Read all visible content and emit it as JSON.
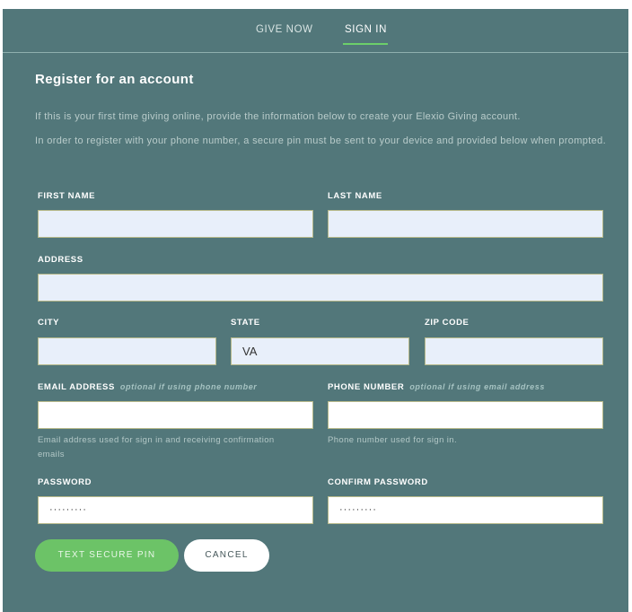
{
  "nav": {
    "tabs": [
      "GIVE NOW",
      "SIGN IN"
    ],
    "active": "SIGN IN"
  },
  "heading": "Register for an account",
  "intro_1": "If this is your first time giving online, provide the information below to create your Elexio Giving account.",
  "intro_2": "In order to register with your phone number, a secure pin must be sent to your device and provided below when prompted.",
  "form": {
    "first_name_label": "FIRST NAME",
    "last_name_label": "LAST NAME",
    "address_label": "ADDRESS",
    "city_label": "CITY",
    "state_label": "STATE",
    "state_value": "VA",
    "zip_label": "ZIP CODE",
    "email_label": "EMAIL ADDRESS",
    "email_optional": "optional if using phone number",
    "email_help": "Email address used for sign in and receiving confirmation emails",
    "phone_label": "PHONE NUMBER",
    "phone_optional": "optional if using email address",
    "phone_help": "Phone number used for sign in.",
    "password_label": "PASSWORD",
    "password_value": "·········",
    "confirm_password_label": "CONFIRM PASSWORD",
    "confirm_password_value": "·········"
  },
  "buttons": {
    "text_pin": "TEXT SECURE PIN",
    "cancel": "CANCEL"
  },
  "colors": {
    "panel": "#52777a",
    "accent_green": "#6cc367",
    "input_fill": "#e8effa"
  }
}
